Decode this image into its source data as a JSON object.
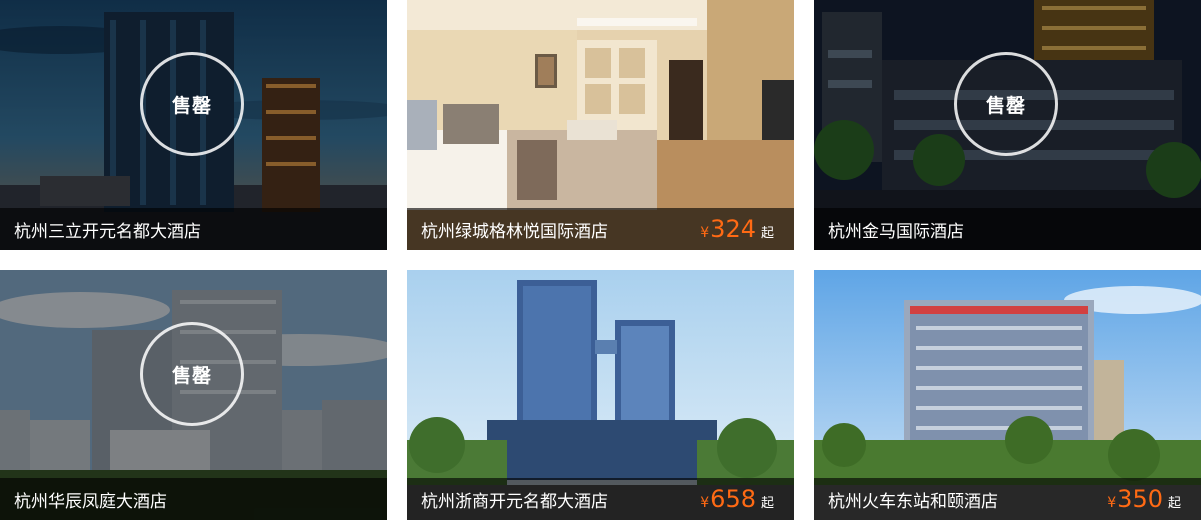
{
  "soldout_label": "售罄",
  "start_suffix": "起",
  "currency": "¥",
  "accent_color": "#ff6a14",
  "hotels": [
    {
      "name": "杭州三立开元名都大酒店",
      "price": null,
      "sold_out": true
    },
    {
      "name": "杭州绿城格林悦国际酒店",
      "price": "324",
      "sold_out": false
    },
    {
      "name": "杭州金马国际酒店",
      "price": null,
      "sold_out": true
    },
    {
      "name": "杭州华辰凤庭大酒店",
      "price": null,
      "sold_out": true
    },
    {
      "name": "杭州浙商开元名都大酒店",
      "price": "658",
      "sold_out": false
    },
    {
      "name": "杭州火车东站和颐酒店",
      "price": "350",
      "sold_out": false
    }
  ]
}
